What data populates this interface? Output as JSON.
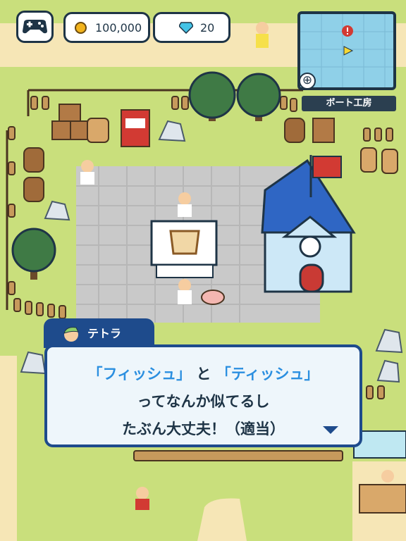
{
  "hud": {
    "coins": "100,000",
    "gems": "20",
    "map_location": "ボート工房"
  },
  "dialog": {
    "speaker": "テトラ",
    "line1_quote1": "「フィッシュ」",
    "line1_mid": "と",
    "line1_quote2": "「ティッシュ」",
    "line2": "ってなんか似てるし",
    "line3": "たぶん大丈夫！（適当）"
  },
  "colors": {
    "grass": "#c9df7c",
    "path": "#f6e6b6",
    "plaza": "#c9c9c9",
    "roof": "#2f66c4",
    "wall": "#cde8f7",
    "dialog_border": "#1e4b8c",
    "highlight": "#2b8fe0"
  }
}
